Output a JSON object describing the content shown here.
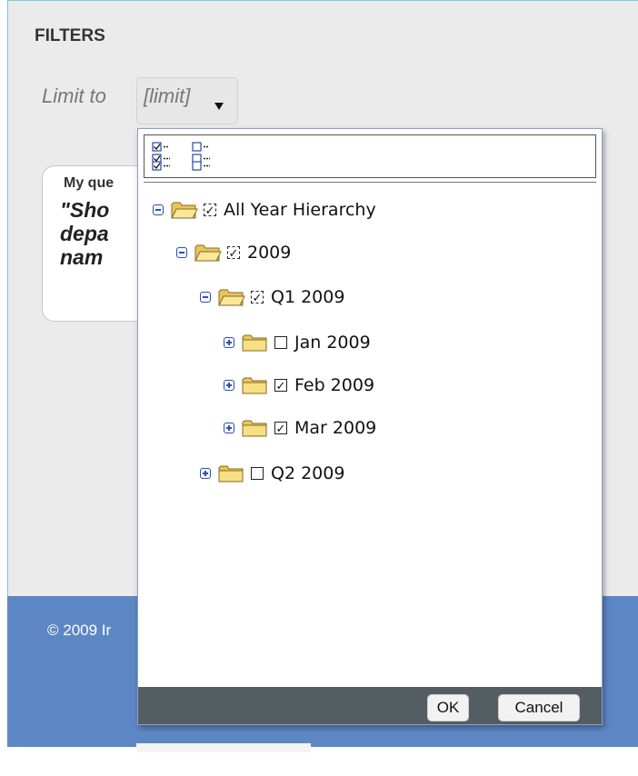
{
  "filters": {
    "title": "FILTERS",
    "limit_label": "Limit to",
    "limit_value": "[limit]"
  },
  "query_card": {
    "heading": "My que",
    "text": "\"Sho\ndepa\nnam"
  },
  "footer": {
    "copyright": "© 2009 Ir"
  },
  "popup": {
    "tree": [
      {
        "label": "All Year Hierarchy",
        "expanded": true,
        "check": "partial"
      },
      {
        "label": "2009",
        "expanded": true,
        "check": "partial"
      },
      {
        "label": "Q1 2009",
        "expanded": true,
        "check": "partial"
      },
      {
        "label": "Jan 2009",
        "expanded": false,
        "check": "unchecked"
      },
      {
        "label": "Feb 2009",
        "expanded": false,
        "check": "checked"
      },
      {
        "label": "Mar 2009",
        "expanded": false,
        "check": "checked"
      },
      {
        "label": "Q2 2009",
        "expanded": false,
        "check": "unchecked"
      }
    ],
    "ok_label": "OK",
    "cancel_label": "Cancel"
  },
  "colors": {
    "footer_blue": "#5d87c4",
    "popup_footer": "#545d62",
    "page_bg": "#ebebeb"
  }
}
